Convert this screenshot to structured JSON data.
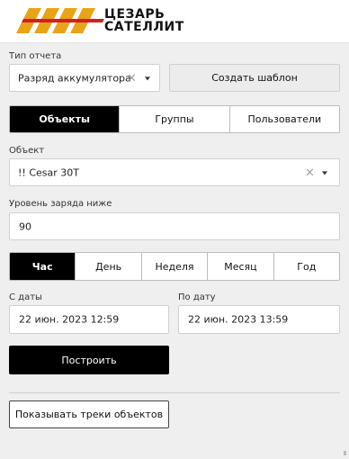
{
  "brand": {
    "line1": "ЦЕЗАРЬ",
    "line2": "САТЕЛЛИТ",
    "stripe_color": "#e8a317",
    "logo_icon": "caesar-stripes-logo"
  },
  "report_type": {
    "label": "Тип отчета",
    "value": "Разряд аккумулятора",
    "clear": "×"
  },
  "create_template_label": "Создать шаблон",
  "tabs_main": {
    "items": [
      "Объекты",
      "Группы",
      "Пользователи"
    ],
    "active": "Объекты"
  },
  "object": {
    "label": "Объект",
    "value": "!! Cesar 30T",
    "clear": "×"
  },
  "charge": {
    "label": "Уровень заряда ниже",
    "value": "90"
  },
  "period": {
    "items": [
      "Час",
      "День",
      "Неделя",
      "Месяц",
      "Год"
    ],
    "active": "Час"
  },
  "date_from": {
    "label": "С даты",
    "value": "22 июн. 2023 12:59"
  },
  "date_to": {
    "label": "По дату",
    "value": "22 июн. 2023 13:59"
  },
  "build_label": "Построить",
  "show_tracks_label": "Показывать треки объектов"
}
